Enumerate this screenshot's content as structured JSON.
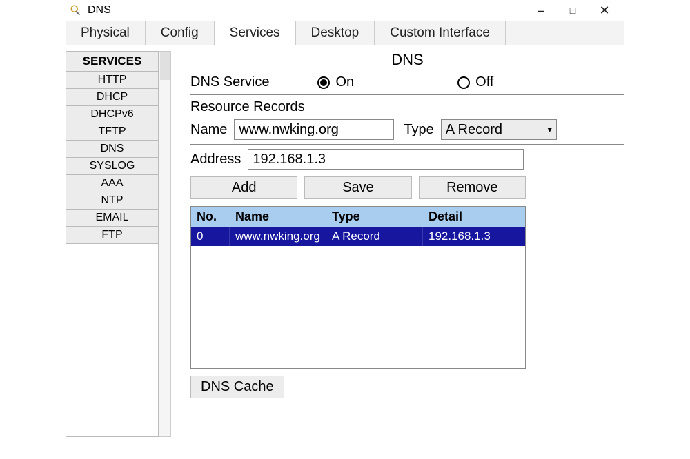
{
  "window": {
    "title": "DNS"
  },
  "tabs": [
    "Physical",
    "Config",
    "Services",
    "Desktop",
    "Custom Interface"
  ],
  "active_tab_index": 2,
  "sidebar": {
    "header": "SERVICES",
    "items": [
      "HTTP",
      "DHCP",
      "DHCPv6",
      "TFTP",
      "DNS",
      "SYSLOG",
      "AAA",
      "NTP",
      "EMAIL",
      "FTP"
    ]
  },
  "panel": {
    "title": "DNS",
    "service_label": "DNS Service",
    "radio": {
      "on_label": "On",
      "off_label": "Off",
      "selected": "on"
    },
    "resource_records_label": "Resource Records",
    "name_label": "Name",
    "name_value": "www.nwking.org",
    "type_label": "Type",
    "type_value": "A Record",
    "address_label": "Address",
    "address_value": "192.168.1.3",
    "buttons": {
      "add": "Add",
      "save": "Save",
      "remove": "Remove"
    },
    "table": {
      "headers": {
        "no": "No.",
        "name": "Name",
        "type": "Type",
        "detail": "Detail"
      },
      "rows": [
        {
          "no": "0",
          "name": "www.nwking.org",
          "type": "A Record",
          "detail": "192.168.1.3"
        }
      ]
    },
    "cache_button": "DNS Cache"
  }
}
